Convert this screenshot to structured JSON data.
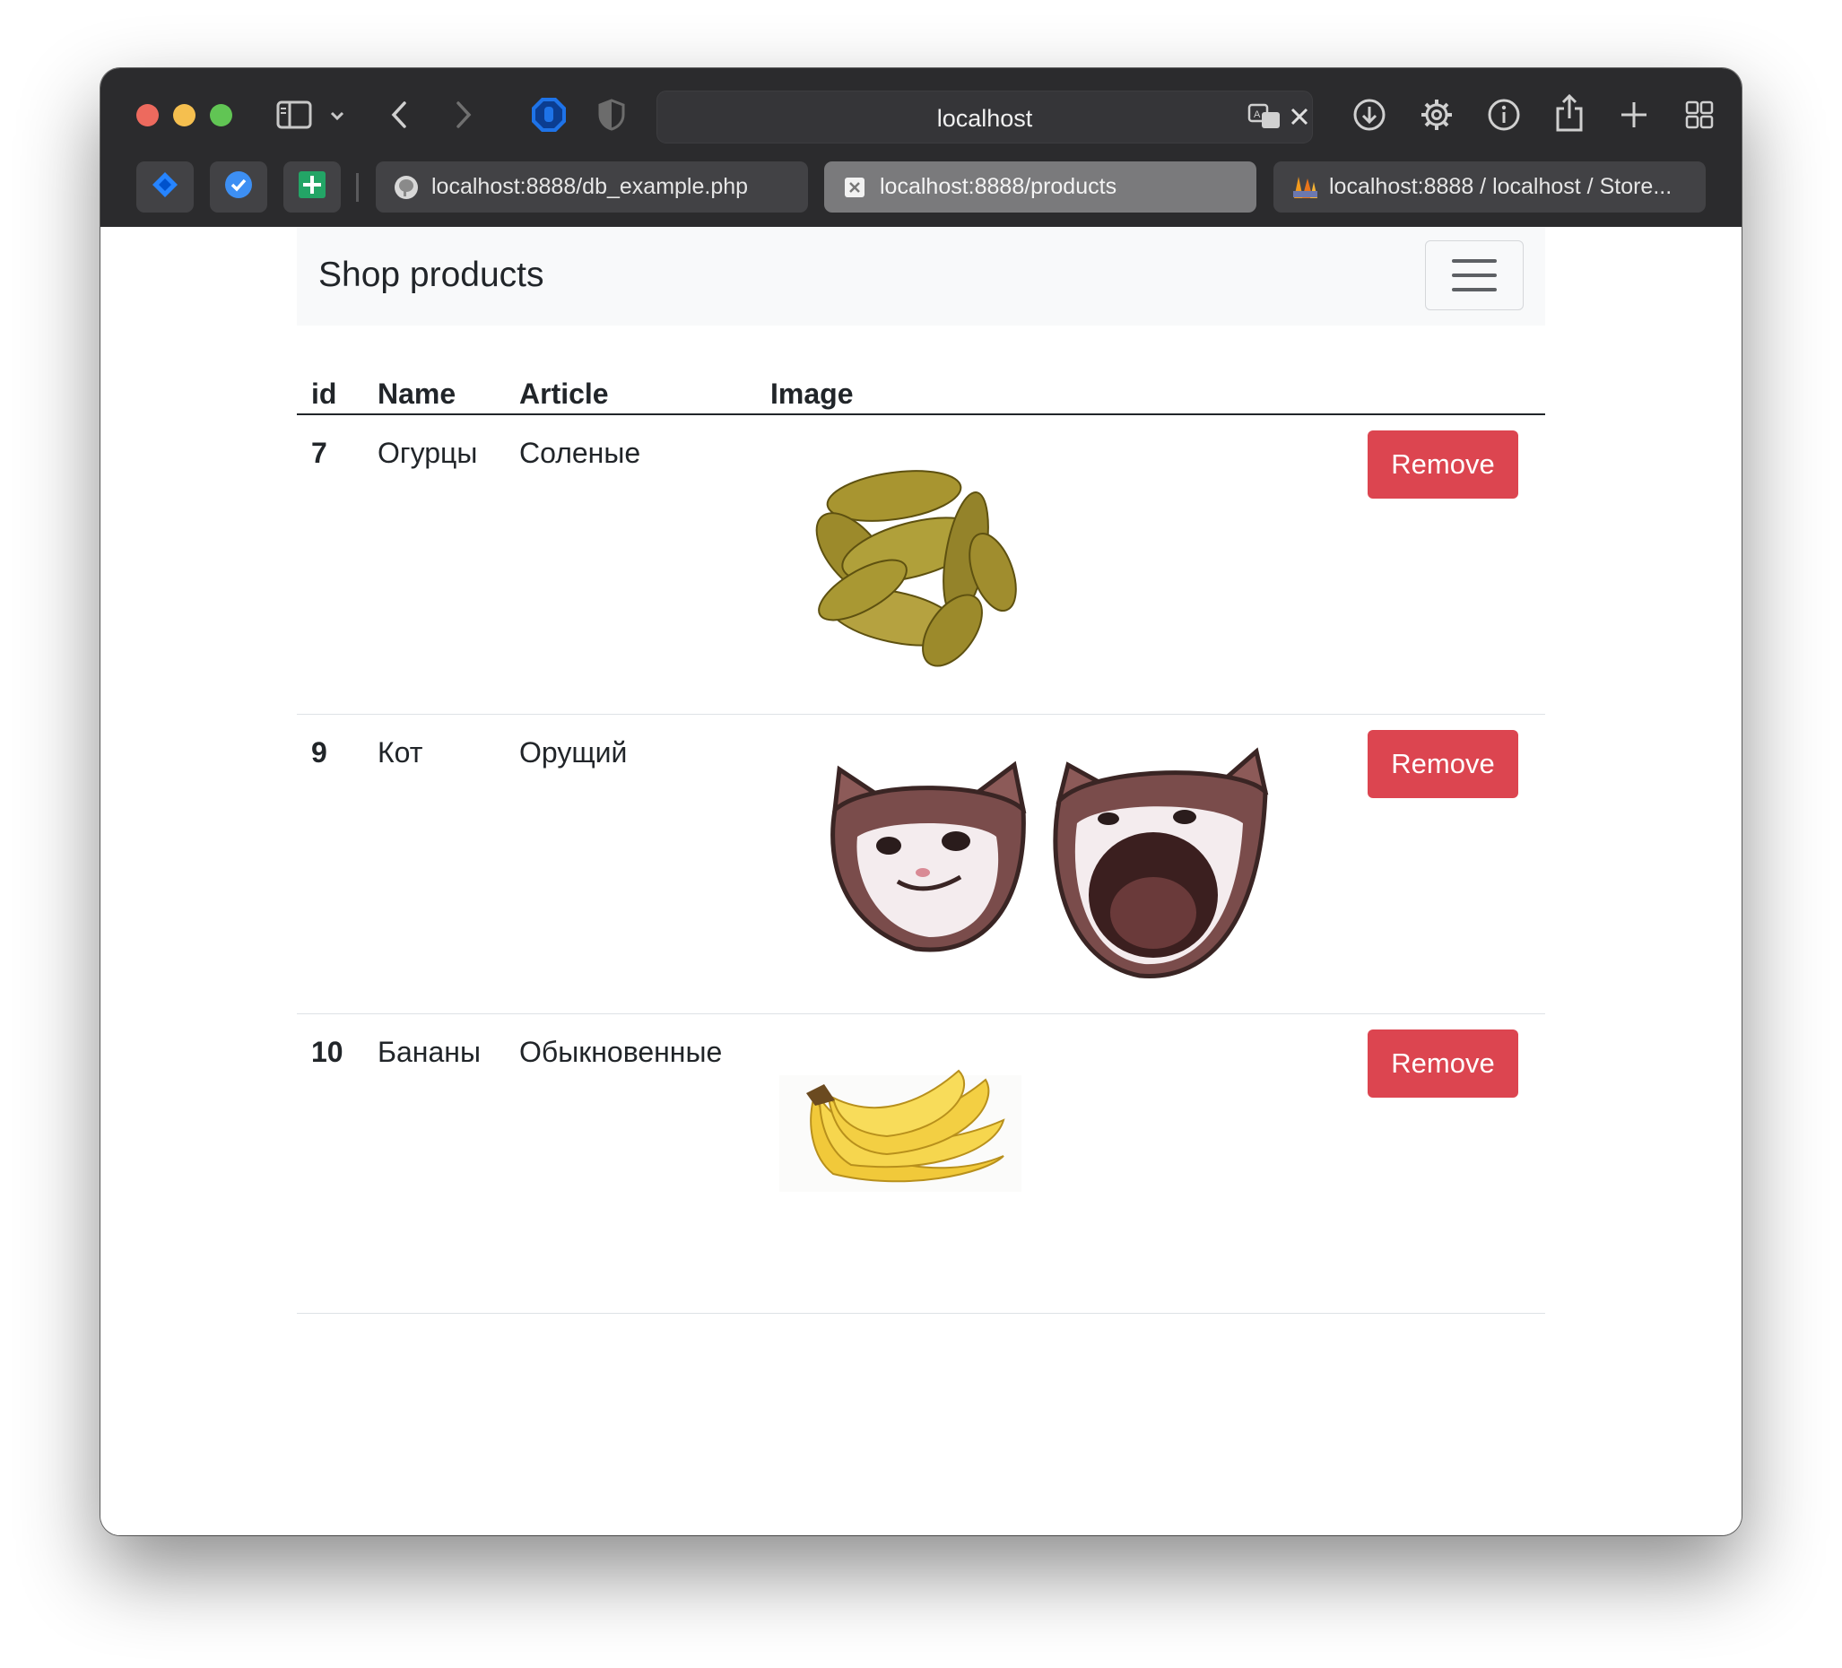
{
  "browser": {
    "address": "localhost",
    "tabs": [
      {
        "label": "localhost:8888/db_example.php",
        "favicon": "elephant-icon",
        "active": false
      },
      {
        "label": "localhost:8888/products",
        "favicon": "page-close-icon",
        "active": true
      },
      {
        "label": "localhost:8888 / localhost / Store...",
        "favicon": "phpmyadmin-icon",
        "active": false
      }
    ],
    "pinned": [
      "jira-icon",
      "tasks-check-icon",
      "sheets-plus-icon"
    ],
    "toolbar_icons": [
      "sidebar-icon",
      "chevron-down-icon",
      "back-icon",
      "forward-icon",
      "adblock-hand-icon",
      "privacy-shield-icon",
      "translate-icon",
      "close-icon",
      "download-icon",
      "settings-gear-icon",
      "info-icon",
      "share-icon",
      "new-tab-plus-icon",
      "tab-overview-icon"
    ]
  },
  "page": {
    "brand": "Shop products",
    "table": {
      "headers": {
        "id": "id",
        "name": "Name",
        "article": "Article",
        "image": "Image"
      },
      "rows": [
        {
          "id": "7",
          "name": "Огурцы",
          "article": "Соленые",
          "image": "pickles-image",
          "action": "Remove"
        },
        {
          "id": "9",
          "name": "Кот",
          "article": "Орущий",
          "image": "popcat-image",
          "action": "Remove"
        },
        {
          "id": "10",
          "name": "Бананы",
          "article": "Обыкновенные",
          "image": "bananas-image",
          "action": "Remove"
        }
      ]
    }
  },
  "colors": {
    "chrome": "#2b2b2d",
    "danger": "#dc4550",
    "navbar": "#f8f9fa",
    "text": "#212529"
  }
}
